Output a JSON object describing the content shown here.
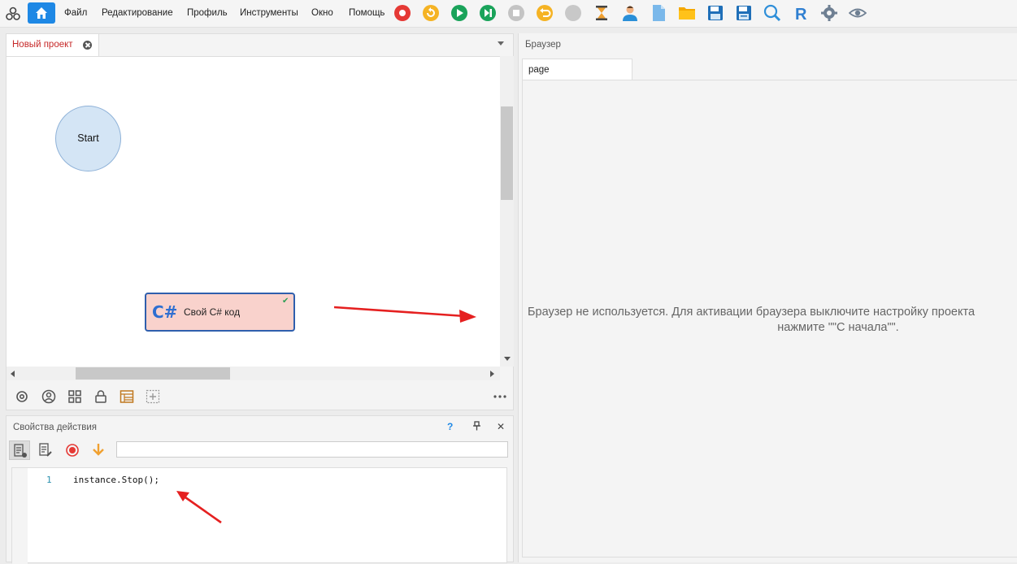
{
  "menu": {
    "items": [
      "Файл",
      "Редактирование",
      "Профиль",
      "Инструменты",
      "Окно",
      "Помощь"
    ]
  },
  "toolbar_icons": [
    "record-icon",
    "refresh-icon",
    "play-icon",
    "step-icon",
    "stop-icon",
    "undo-icon",
    "disabled-icon",
    "hourglass-icon",
    "user-icon",
    "file-icon",
    "folder-icon",
    "save-icon",
    "save-as-icon",
    "search-icon",
    "r-icon",
    "gear-icon",
    "eye-icon"
  ],
  "project_panel": {
    "tab_label": "Новый проект",
    "start_node_label": "Start",
    "cs_node": {
      "icon_text": "C#",
      "label": "Свой C# код"
    }
  },
  "properties_panel": {
    "title": "Свойства действия",
    "help_label": "?",
    "pin_label": "🖈",
    "close_label": "✕",
    "input_value": "",
    "code_line_number": "1",
    "code_text": "instance.Stop();"
  },
  "browser_panel": {
    "title": "Браузер",
    "tab_label": "page",
    "message_line1": "Браузер не используется. Для активации браузера выключите настройку проекта",
    "message_line2": "нажмите \"\"С начала\"\"."
  },
  "colors": {
    "accent": "#1e88e5",
    "tab_active_text": "#c62828",
    "annotation_arrow": "#e52020"
  }
}
